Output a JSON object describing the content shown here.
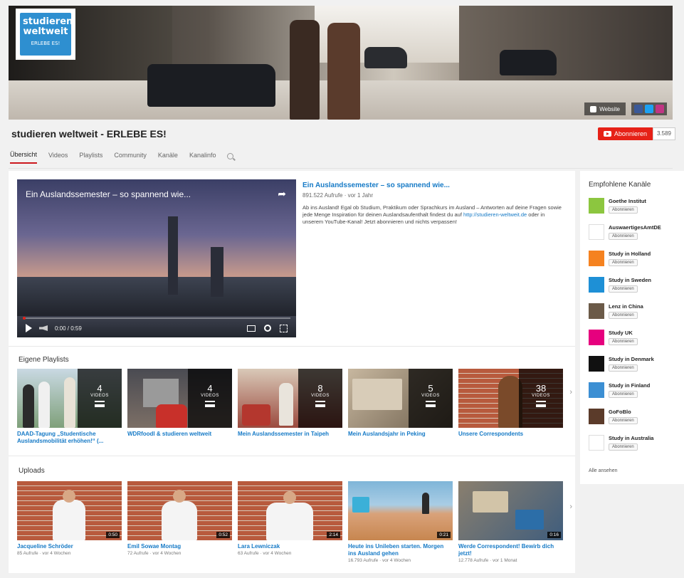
{
  "channel": {
    "logo_text_line1": "studieren",
    "logo_text_line2": "weltweit",
    "logo_text_line3": "ERLEBE ES!",
    "title": "studieren weltweit - ERLEBE ES!",
    "subscribe_label": "Abonnieren",
    "subscriber_count": "3.589",
    "website_link_label": "Website"
  },
  "tabs": [
    {
      "label": "Übersicht",
      "active": true
    },
    {
      "label": "Videos"
    },
    {
      "label": "Playlists"
    },
    {
      "label": "Community"
    },
    {
      "label": "Kanäle"
    },
    {
      "label": "Kanalinfo"
    }
  ],
  "featured": {
    "overlay_title": "Ein Auslandssemester – so spannend wie...",
    "title": "Ein Auslandssemester – so spannend wie...",
    "meta": "891.522 Aufrufe · vor 1 Jahr",
    "description_before": "Ab ins Ausland! Egal ob Studium, Praktikum oder Sprachkurs im Ausland – Antworten auf deine Fragen sowie jede Menge Inspiration für deinen Auslandsaufenthalt findest du auf ",
    "description_link": "http://studieren-weltweit.de",
    "description_after": " oder in unserem YouTube-Kanal! Jetzt abonnieren und nichts verpassen!",
    "time": "0:00 / 0:59"
  },
  "playlists": {
    "title": "Eigene Playlists",
    "items": [
      {
        "title": "DAAD-Tagung „Studentische Auslandsmobilität erhöhen!“ (...",
        "count": "4",
        "label": "VIDEOS"
      },
      {
        "title": "WDRfoodl & studieren weltweit",
        "count": "4",
        "label": "VIDEOS"
      },
      {
        "title": "Mein Auslandssemester in Taipeh",
        "count": "8",
        "label": "VIDEOS"
      },
      {
        "title": "Mein Auslandsjahr in Peking",
        "count": "5",
        "label": "VIDEOS"
      },
      {
        "title": "Unsere Correspondents",
        "count": "38",
        "label": "VIDEOS"
      }
    ]
  },
  "uploads": {
    "title": "Uploads",
    "items": [
      {
        "title": "Jacqueline Schröder",
        "meta": "85 Aufrufe · vor 4 Wochen",
        "duration": "0:50"
      },
      {
        "title": "Emil Sowae Montag",
        "meta": "72 Aufrufe · vor 4 Wochen",
        "duration": "0:52"
      },
      {
        "title": "Lara Lewniczak",
        "meta": "63 Aufrufe · vor 4 Wochen",
        "duration": "2:14"
      },
      {
        "title": "Heute ins Unileben starten. Morgen ins Ausland gehen",
        "meta": "16.793 Aufrufe · vor 4 Wochen",
        "duration": "0:21"
      },
      {
        "title": "Werde Correspondent! Bewirb dich jetzt!",
        "meta": "12.778 Aufrufe · vor 1 Monat",
        "duration": "0:16"
      }
    ]
  },
  "sidebar": {
    "title": "Empfohlene Kanäle",
    "subscribe_label": "Abonnieren",
    "see_all": "Alle ansehen",
    "channels": [
      {
        "name": "Goethe Institut",
        "color": "#8cc63f"
      },
      {
        "name": "AuswaertigesAmtDE",
        "color": "#ffffff"
      },
      {
        "name": "Study in Holland",
        "color": "#f58220"
      },
      {
        "name": "Study in Sweden",
        "color": "#1e90d6"
      },
      {
        "name": "Lenz in China",
        "color": "#6b5a48"
      },
      {
        "name": "Study UK",
        "color": "#e6007e"
      },
      {
        "name": "Study in Denmark",
        "color": "#111111"
      },
      {
        "name": "Study in Finland",
        "color": "#3c8fd3"
      },
      {
        "name": "GoFoBlo",
        "color": "#5b3b2a"
      },
      {
        "name": "Study in Australia",
        "color": "#ffffff"
      }
    ]
  }
}
